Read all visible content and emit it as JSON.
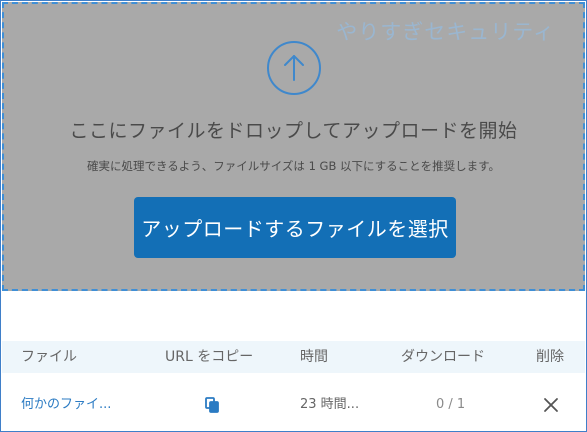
{
  "brand": {
    "text": "やりすぎセキュリティ"
  },
  "dropzone": {
    "icon": "arrow-up-circle-icon",
    "title": "ここにファイルをドロップしてアップロードを開始",
    "subtitle": "確実に処理できるよう、ファイルサイズは 1 GB 以下にすることを推奨します。",
    "select_button": "アップロードするファイルを選択"
  },
  "table": {
    "headers": {
      "file": "ファイル",
      "copy_url": "URL をコピー",
      "time": "時間",
      "download": "ダウンロード",
      "delete": "削除"
    },
    "rows": [
      {
        "file": "何かのファイ...",
        "copy_icon": "copy-icon",
        "time": "23 時間...",
        "download": "0 / 1",
        "delete_icon": "close-icon"
      }
    ]
  },
  "colors": {
    "accent": "#136fb6",
    "link": "#2b7bc3",
    "dashed_border": "#3f8fd6",
    "dropzone_bg": "#a9a9a9",
    "header_bg": "#eef6fb"
  }
}
